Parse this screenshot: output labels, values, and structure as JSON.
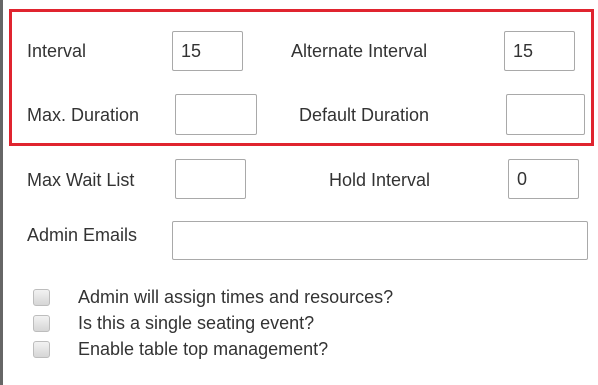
{
  "settings": {
    "interval": {
      "label": "Interval",
      "value": "15"
    },
    "alternate_interval": {
      "label": "Alternate Interval",
      "value": "15"
    },
    "max_duration": {
      "label": "Max. Duration",
      "value": ""
    },
    "default_duration": {
      "label": "Default Duration",
      "value": ""
    },
    "max_wait_list": {
      "label": "Max Wait List",
      "value": ""
    },
    "hold_interval": {
      "label": "Hold Interval",
      "value": "0"
    },
    "admin_emails": {
      "label": "Admin Emails",
      "value": ""
    }
  },
  "options": [
    {
      "label": "Admin will assign times and resources?",
      "checked": false
    },
    {
      "label": "Is this a single seating event?",
      "checked": false
    },
    {
      "label": "Enable table top management?",
      "checked": false
    }
  ],
  "colors": {
    "highlight": "#e0242f"
  }
}
